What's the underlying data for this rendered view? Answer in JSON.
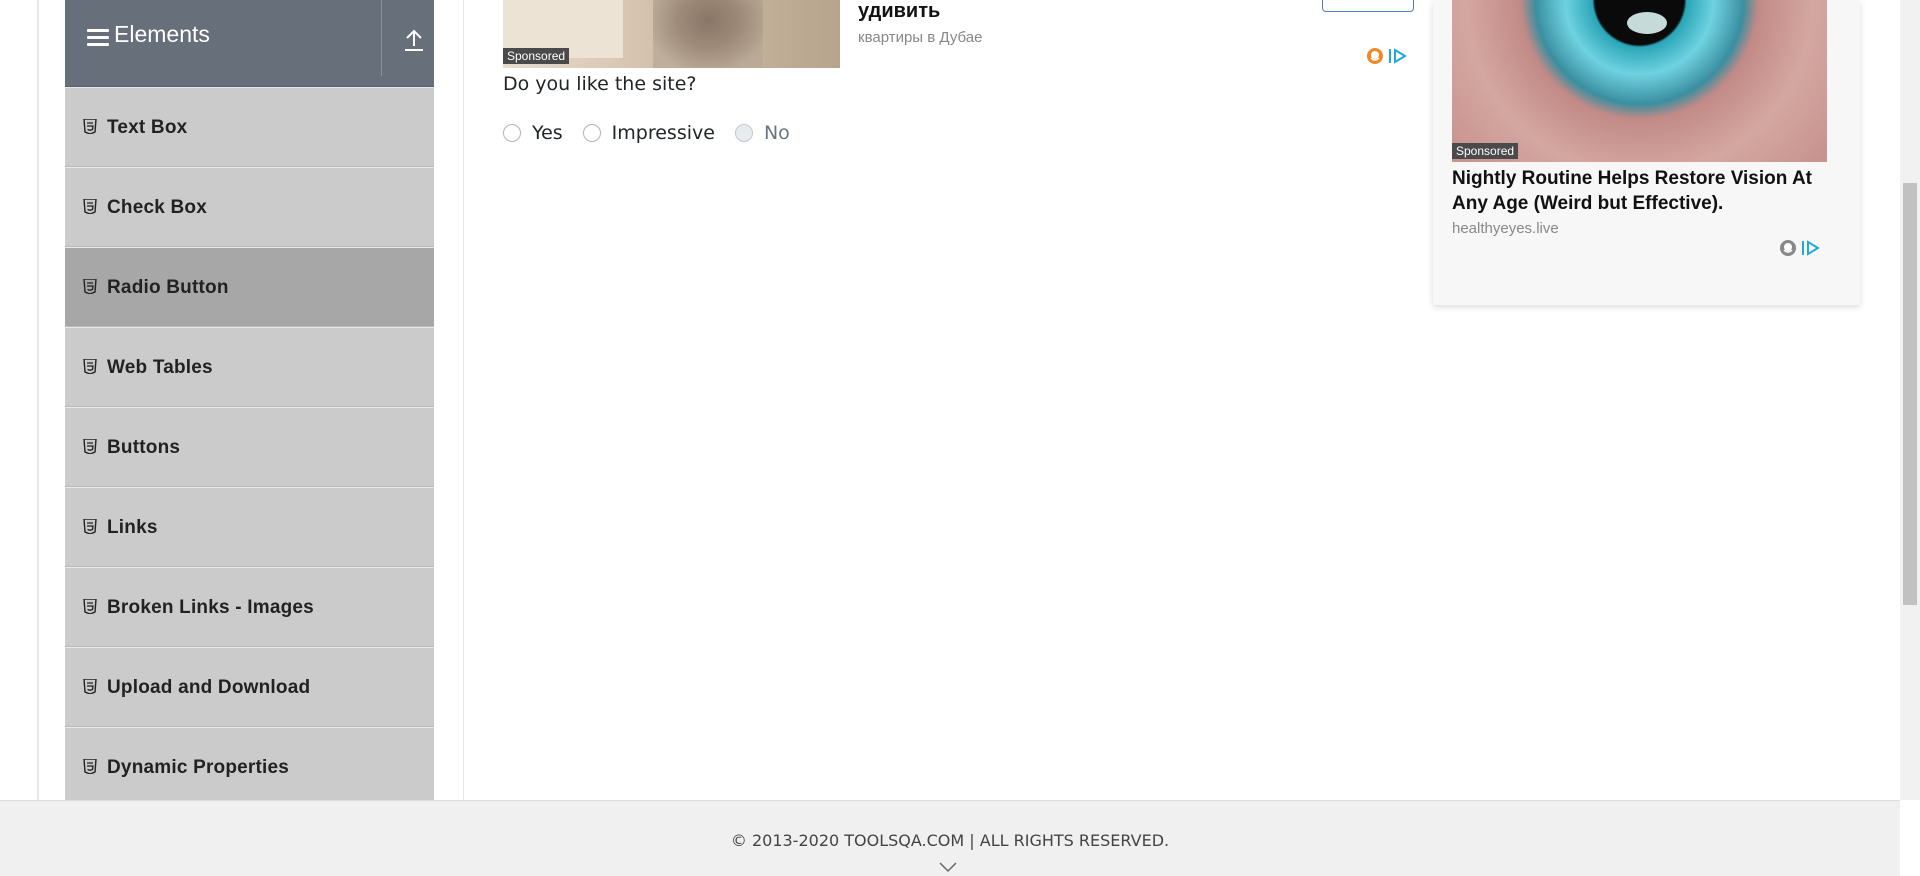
{
  "sidebar": {
    "group_title": "Elements",
    "items": [
      {
        "label": "Text Box",
        "active": false
      },
      {
        "label": "Check Box",
        "active": false
      },
      {
        "label": "Radio Button",
        "active": true
      },
      {
        "label": "Web Tables",
        "active": false
      },
      {
        "label": "Buttons",
        "active": false
      },
      {
        "label": "Links",
        "active": false
      },
      {
        "label": "Broken Links - Images",
        "active": false
      },
      {
        "label": "Upload and Download",
        "active": false
      },
      {
        "label": "Dynamic Properties",
        "active": false
      }
    ]
  },
  "top_ad": {
    "sponsored": "Sponsored",
    "title": "удивить",
    "source": "квартиры в Дубае"
  },
  "main": {
    "question": "Do you like the site?",
    "options": [
      {
        "label": "Yes",
        "disabled": false
      },
      {
        "label": "Impressive",
        "disabled": false
      },
      {
        "label": "No",
        "disabled": true
      }
    ]
  },
  "right_ad": {
    "sponsored": "Sponsored",
    "headline": "Nightly Routine Helps Restore Vision At Any Age (Weird but Effective).",
    "domain": "healthyeyes.live"
  },
  "footer": {
    "copyright": "© 2013-2020 TOOLSQA.COM | ALL RIGHTS RESERVED."
  },
  "icons": {
    "menu": "hamburger-icon",
    "collapse": "upload-icon",
    "item": "html5-icon",
    "adchoices": "adchoices-icon",
    "footer": "chevron-down-icon"
  }
}
